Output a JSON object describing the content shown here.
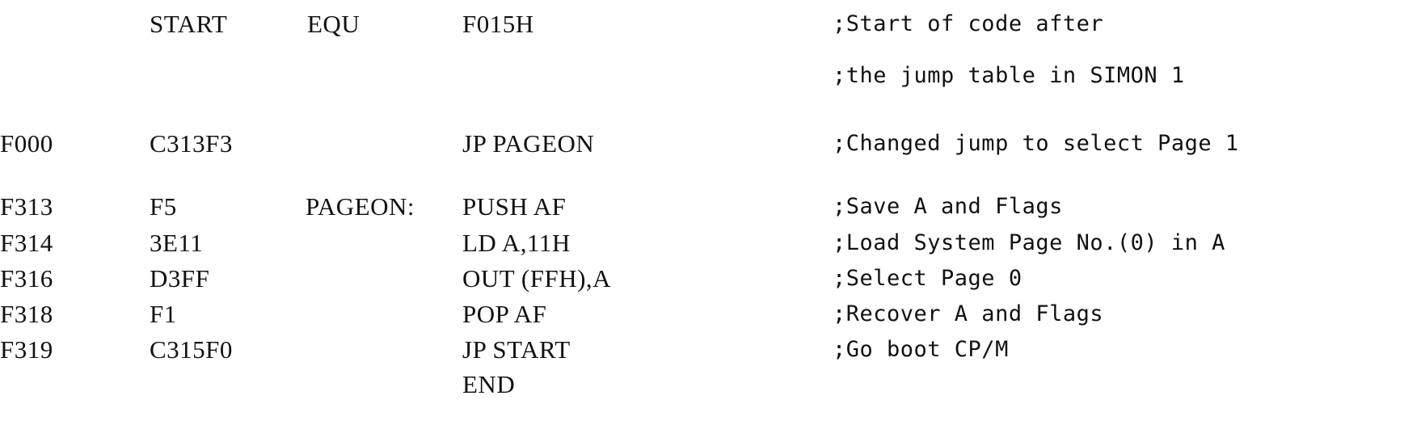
{
  "listing": {
    "lines": [
      {
        "address": "",
        "code": "START",
        "label": "EQU",
        "instruction": "F015H",
        "comment": ";Start of code after"
      },
      {
        "address": "",
        "code": "",
        "label": "",
        "instruction": "",
        "comment": ";the jump table in SIMON 1"
      },
      {
        "address": "F000",
        "code": "C313F3",
        "label": "",
        "instruction": "JP PAGEON",
        "comment": ";Changed jump to select Page 1"
      },
      {
        "address": "F313",
        "code": "F5",
        "label": "PAGEON:",
        "instruction": "PUSH AF",
        "comment": ";Save A and Flags"
      },
      {
        "address": "F314",
        "code": "3E11",
        "label": "",
        "instruction": "LD A,11H",
        "comment": ";Load System Page No.(0) in A"
      },
      {
        "address": "F316",
        "code": "D3FF",
        "label": "",
        "instruction": "OUT (FFH),A",
        "comment": ";Select Page 0"
      },
      {
        "address": "F318",
        "code": "F1",
        "label": "",
        "instruction": "POP AF",
        "comment": ";Recover A and Flags"
      },
      {
        "address": "F319",
        "code": "C315F0",
        "label": "",
        "instruction": "JP START",
        "comment": ";Go boot CP/M"
      },
      {
        "address": "",
        "code": "",
        "label": "",
        "instruction": "END",
        "comment": ""
      }
    ]
  }
}
